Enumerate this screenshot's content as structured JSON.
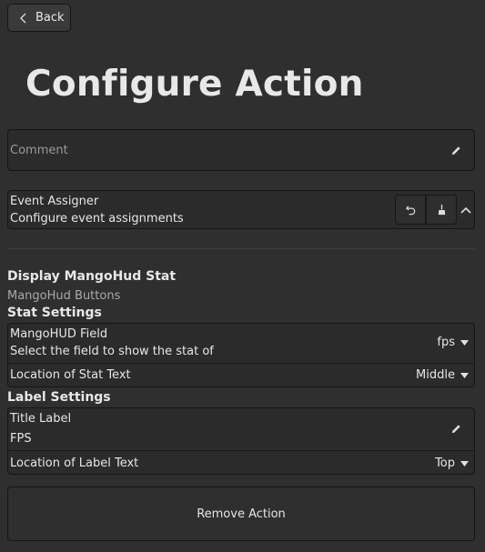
{
  "header": {
    "back_label": "Back",
    "title": "Configure Action"
  },
  "comment": {
    "placeholder": "Comment"
  },
  "event_assigner": {
    "title": "Event Assigner",
    "subtitle": "Configure event assignments"
  },
  "action": {
    "name": "Display MangoHud Stat",
    "category": "MangoHud Buttons"
  },
  "stat_settings": {
    "heading": "Stat Settings",
    "field": {
      "label": "MangoHUD Field",
      "description": "Select the field to show the stat of",
      "value": "fps"
    },
    "location": {
      "label": "Location of Stat Text",
      "value": "Middle"
    }
  },
  "label_settings": {
    "heading": "Label Settings",
    "title_label": {
      "label": "Title Label",
      "value": "FPS"
    },
    "location": {
      "label": "Location of Label Text",
      "value": "Top"
    }
  },
  "remove_label": "Remove Action",
  "icons": [
    "chevron-left-icon",
    "pencil-icon",
    "undo-icon",
    "broom-icon",
    "chevron-up-icon",
    "caret-down-icon"
  ]
}
